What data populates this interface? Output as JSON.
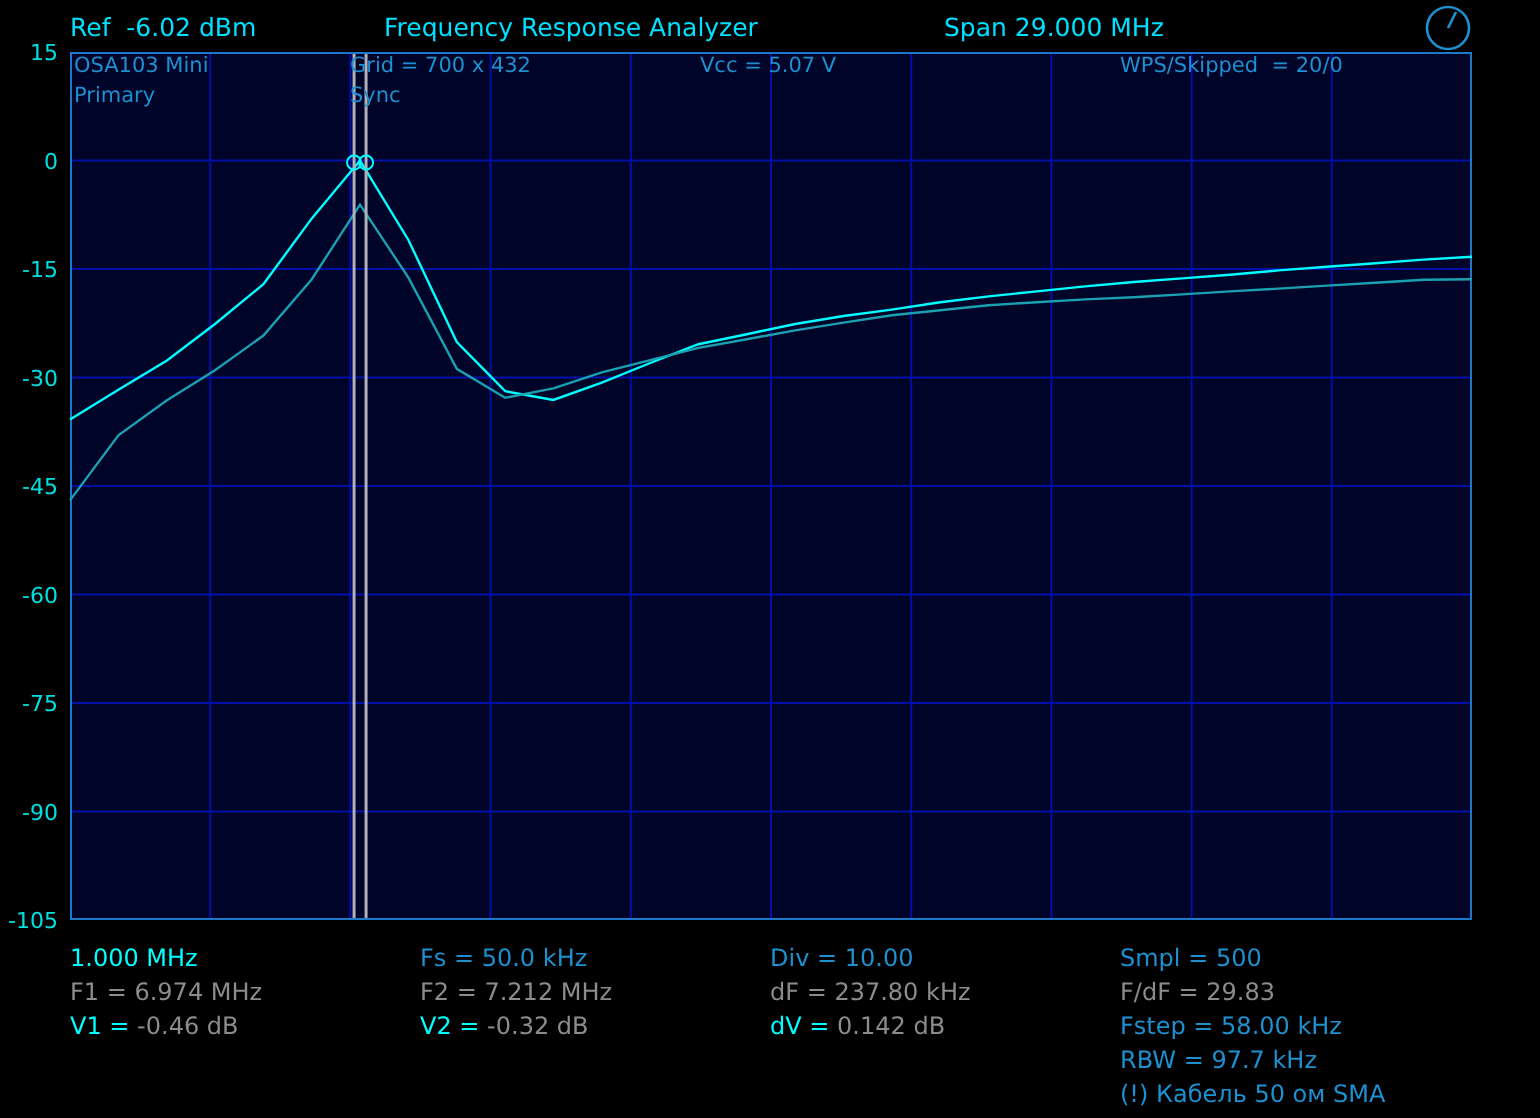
{
  "header": {
    "ref": "Ref  -6.02 dBm",
    "title": "Frequency Response Analyzer",
    "span": "Span 29.000 MHz"
  },
  "plot": {
    "info": [
      [
        "OSA103 Mini",
        "Primary"
      ],
      [
        "Grid = 700 x 432",
        "Sync"
      ],
      [
        "Vcc = 5.07 V"
      ],
      [
        "WPS/Skipped  = 20/0"
      ]
    ],
    "chart_data": {
      "type": "line",
      "grid": true,
      "ylim": [
        -105,
        15
      ],
      "yticks": [
        15,
        0,
        -15,
        -30,
        -45,
        -60,
        -75,
        -90,
        -105
      ],
      "categories": [
        null,
        null,
        null,
        null,
        null,
        null,
        null,
        null,
        null,
        null,
        null,
        null,
        null,
        null,
        null,
        null,
        null,
        null,
        null,
        null,
        null,
        null,
        null,
        null,
        null,
        null,
        null,
        null,
        null,
        null
      ],
      "series": [
        {
          "color": "#00ffff",
          "values": [
            -35.8,
            -31.7,
            -27.7,
            -22.6,
            -17.1,
            -8.0,
            0,
            -11,
            -25.1,
            -31.9,
            -33.1,
            -30.7,
            -28,
            -25.4,
            -24,
            -22.6,
            -21.5,
            -20.6,
            -19.6,
            -18.8,
            -18.1,
            -17.4,
            -16.8,
            -16.3,
            -15.8,
            -15.2,
            -14.7,
            -14.2,
            -13.7,
            -13.3
          ]
        },
        {
          "color": "#1aa0b0",
          "values": [
            -47,
            -38,
            -33.2,
            -29,
            -24.2,
            -16.4,
            -6.1,
            -16.2,
            -28.8,
            -32.8,
            -31.5,
            -29.3,
            -27.6,
            -25.9,
            -24.7,
            -23.5,
            -22.4,
            -21.4,
            -20.7,
            -20,
            -19.6,
            -19.2,
            -18.9,
            -18.5,
            -18.1,
            -17.7,
            -17.3,
            -16.9,
            -16.5,
            -16.4
          ]
        }
      ]
    }
  },
  "readouts": [
    [
      {
        "text": "1.000 MHz",
        "color": "#00ffff"
      },
      {
        "text": "F1 = 6.974 MHz",
        "color": "#8c8c8c"
      },
      {
        "text": "V1 =",
        "color": "#00ffff",
        "value": {
          "text": "-0.46 dB",
          "color": "#8c8c8c"
        }
      }
    ],
    [
      {
        "text": "Fs = 50.0 kHz",
        "color": "#1e90d0"
      },
      {
        "text": "F2 = 7.212 MHz",
        "color": "#8c8c8c"
      },
      {
        "text": "V2 =",
        "color": "#00ffff",
        "value": {
          "text": "-0.32 dB",
          "color": "#8c8c8c"
        }
      }
    ],
    [
      {
        "text": "Div = 10.00",
        "color": "#1e90d0"
      },
      {
        "text": "dF = 237.80 kHz",
        "color": "#8c8c8c"
      },
      {
        "text": "dV =",
        "color": "#00ffff",
        "value": {
          "text": "0.142 dB",
          "color": "#8c8c8c"
        }
      }
    ],
    [
      {
        "text": "Smpl = 500",
        "color": "#1e90d0"
      },
      {
        "text": "F/dF = 29.83",
        "color": "#8c8c8c"
      },
      {
        "text": "Fstep = 58.00 kHz",
        "color": "#1e90d0"
      },
      {
        "text": "RBW = 97.7 kHz",
        "color": "#1e90d0"
      },
      {
        "text": "(!) Кабель 50 ом SMA",
        "color": "#1e90d0"
      }
    ]
  ]
}
